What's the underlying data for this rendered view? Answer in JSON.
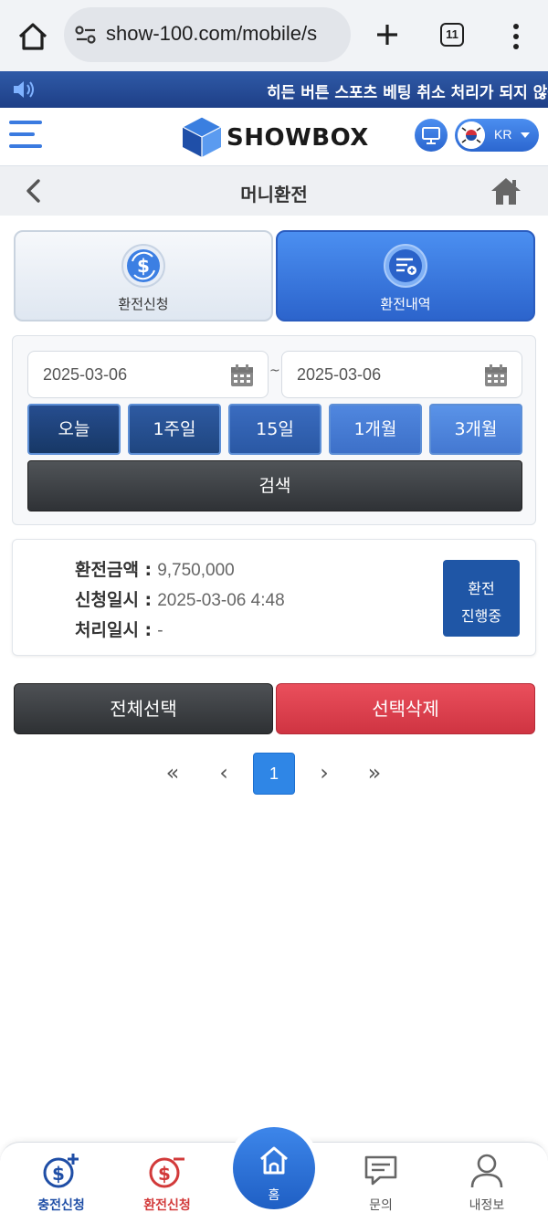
{
  "browser": {
    "url": "show-100.com/mobile/s",
    "tab_count": "11"
  },
  "notice": {
    "text": "히든 버튼 스포츠 베팅 취소 처리가 되지 않습"
  },
  "header": {
    "logo_text": "SHOWBOX",
    "language": "KR"
  },
  "page": {
    "title": "머니환전"
  },
  "tabs": [
    {
      "label": "환전신청",
      "active": false
    },
    {
      "label": "환전내역",
      "active": true
    }
  ],
  "search": {
    "date_from": "2025-03-06",
    "date_to": "2025-03-06",
    "separator": "~",
    "periods": [
      "오늘",
      "1주일",
      "15일",
      "1개월",
      "3개월"
    ],
    "search_label": "검색"
  },
  "records": [
    {
      "amount_label": "환전금액 :",
      "amount": "9,750,000",
      "request_label": "신청일시 :",
      "request_time": "2025-03-06 4:48",
      "process_label": "처리일시 :",
      "process_time": "-",
      "status_line1": "환전",
      "status_line2": "진행중"
    }
  ],
  "actions": {
    "select_all": "전체선택",
    "delete_selected": "선택삭제"
  },
  "pagination": {
    "first": "«",
    "prev": "‹",
    "current": "1",
    "next": "›",
    "last": "»"
  },
  "bottom_nav": {
    "items": [
      {
        "label": "충전신청",
        "icon": "deposit-icon"
      },
      {
        "label": "환전신청",
        "icon": "withdraw-icon"
      },
      {
        "label": "홈",
        "icon": "home-icon"
      },
      {
        "label": "문의",
        "icon": "chat-icon"
      },
      {
        "label": "내정보",
        "icon": "user-icon"
      }
    ]
  },
  "colors": {
    "primary": "#2f6fd8",
    "danger": "#d93a48",
    "dark": "#3a3d41"
  }
}
